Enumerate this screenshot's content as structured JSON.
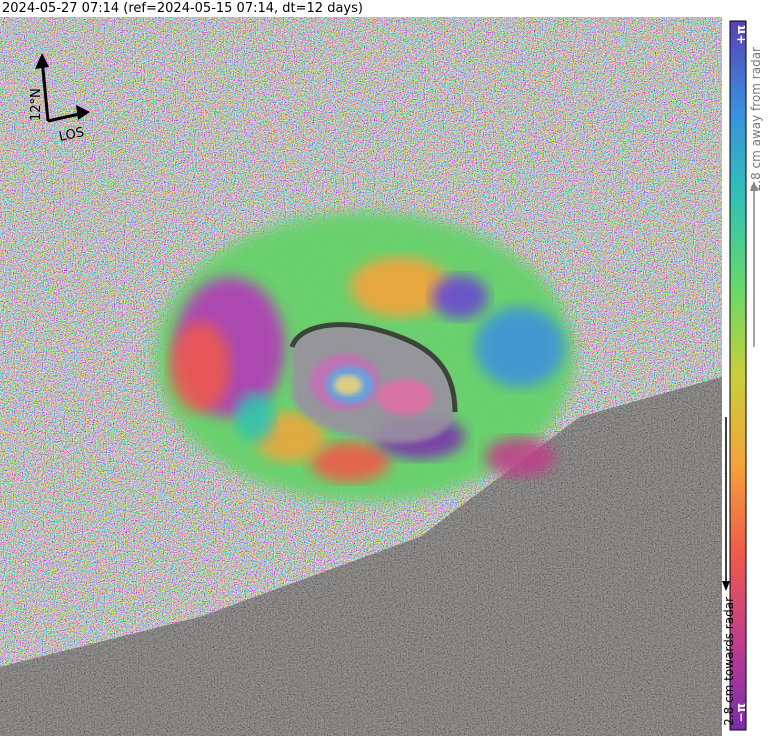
{
  "header": {
    "title": "2024-05-27 07:14 (ref=2024-05-15 07:14, dt=12 days)"
  },
  "map": {
    "north_arrow_label": "12°N",
    "los_label": "LOS"
  },
  "colorbar": {
    "top_label": "+π",
    "bottom_label": "−π",
    "away_label": "2.8 cm away from radar",
    "towards_label": "2.8 cm towards radar",
    "colors": [
      "#7a2bb0",
      "#c03e8a",
      "#f05a4a",
      "#f4a33b",
      "#c8cf3a",
      "#67d86a",
      "#2fc2b5",
      "#3b8fe0",
      "#5a3fb8"
    ]
  }
}
